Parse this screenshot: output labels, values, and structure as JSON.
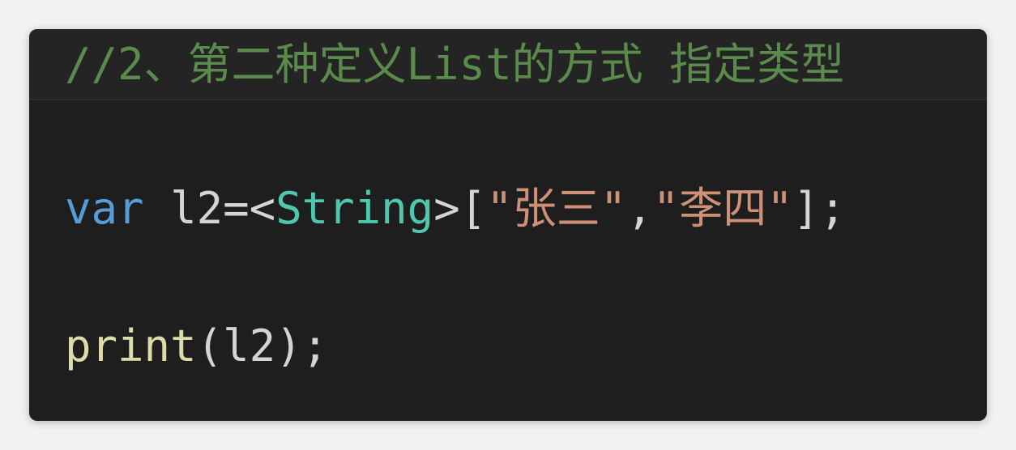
{
  "editor": {
    "comment": "//2、第二种定义List的方式 指定类型",
    "declaration": {
      "keyword": "var",
      "space": " ",
      "variable": "l2",
      "assign": "=",
      "open_angle": "<",
      "type": "String",
      "close_angle": ">",
      "open_bracket": "[",
      "string1": "\"张三\"",
      "comma": ",",
      "string2": "\"李四\"",
      "close_bracket": "]",
      "semicolon": ";"
    },
    "call": {
      "function": "print",
      "open_paren": "(",
      "argument": "l2",
      "close_paren": ")",
      "semicolon": ";"
    }
  },
  "colors": {
    "background": "#1e1e1e",
    "comment": "#5a8a4c",
    "keyword": "#569cd6",
    "type": "#4ec9b0",
    "string": "#ce9178",
    "function": "#dcdcaa"
  }
}
